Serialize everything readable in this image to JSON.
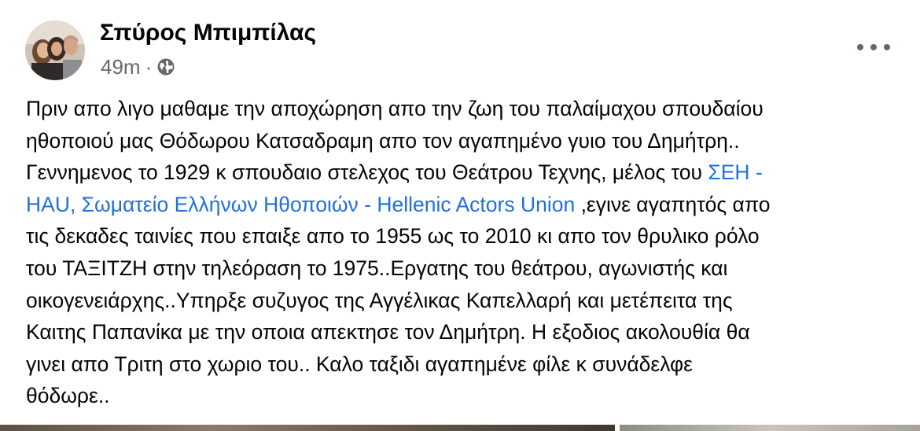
{
  "post": {
    "author_name": "Σπύρος Μπιμπίλας",
    "timestamp": "49m",
    "separator": "·",
    "audience_icon": "globe-icon",
    "more_icon": "more-options-icon",
    "text_lines": [
      "Πριν απο λιγο μαθαμε την αποχώρηση απο την ζωη του παλαίμαχου σπουδαίου",
      "ηθοποιού μας Θόδωρου Κατσαδραμη  απο τον αγαπημένο γυιο του Δημήτρη..",
      "Γεννημενος το 1929 κ σπουδαιο στελεχος του Θεάτρου Τεχνης, μέλος του "
    ],
    "mention_part1": "ΣΕΗ -",
    "mention_part2": "HAU, Σωματείο Ελλήνων Ηθοποιών - Hellenic Actors Union",
    "line4_rest": " ,εγινε αγαπητός απο",
    "text_lines_after": [
      "τις δεκαδες ταινίες που επαιξε απο το 1955 ως το 2010 κι απο τον θρυλικο ρόλο",
      "του ΤΑΞΙΤΖΗ στην τηλεόραση το 1975..Εργατης του θεάτρου, αγωνιστής και",
      "οικογενειάρχης..Υπηρξε συζυγος της Αγγέλικας Καπελλαρή και μετέπειτα της",
      "Καιτης Παπανίκα με την οποια απεκτησε τον Δημήτρη. Η εξοδιος ακολουθία θα",
      "γινει απο Τριτη στο χωριο του.. Καλο ταξιδι αγαπημένε φίλε κ συνάδελφε",
      "θόδωρε.."
    ],
    "colors": {
      "text": "#050505",
      "secondary": "#65676b",
      "link": "#216fdb"
    }
  }
}
